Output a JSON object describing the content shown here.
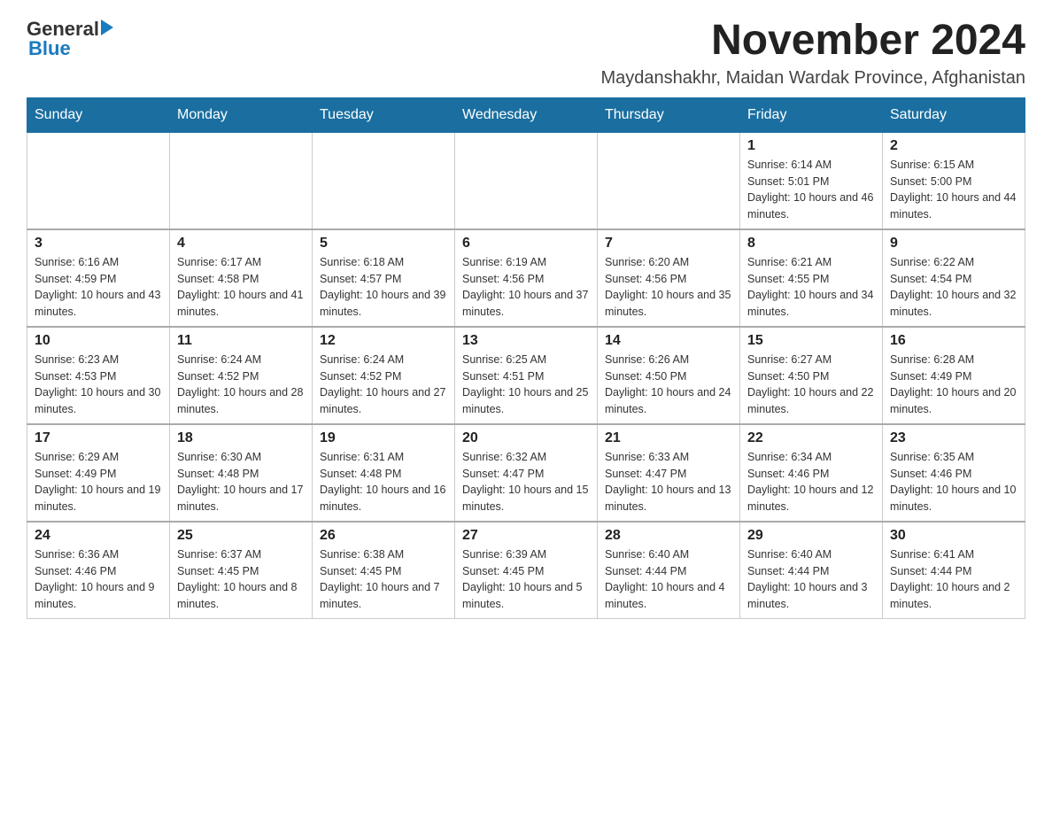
{
  "header": {
    "logo": {
      "general": "General",
      "blue": "Blue"
    },
    "month_year": "November 2024",
    "location": "Maydanshakhr, Maidan Wardak Province, Afghanistan"
  },
  "days_of_week": [
    "Sunday",
    "Monday",
    "Tuesday",
    "Wednesday",
    "Thursday",
    "Friday",
    "Saturday"
  ],
  "weeks": [
    [
      {
        "day": "",
        "info": ""
      },
      {
        "day": "",
        "info": ""
      },
      {
        "day": "",
        "info": ""
      },
      {
        "day": "",
        "info": ""
      },
      {
        "day": "",
        "info": ""
      },
      {
        "day": "1",
        "info": "Sunrise: 6:14 AM\nSunset: 5:01 PM\nDaylight: 10 hours and 46 minutes."
      },
      {
        "day": "2",
        "info": "Sunrise: 6:15 AM\nSunset: 5:00 PM\nDaylight: 10 hours and 44 minutes."
      }
    ],
    [
      {
        "day": "3",
        "info": "Sunrise: 6:16 AM\nSunset: 4:59 PM\nDaylight: 10 hours and 43 minutes."
      },
      {
        "day": "4",
        "info": "Sunrise: 6:17 AM\nSunset: 4:58 PM\nDaylight: 10 hours and 41 minutes."
      },
      {
        "day": "5",
        "info": "Sunrise: 6:18 AM\nSunset: 4:57 PM\nDaylight: 10 hours and 39 minutes."
      },
      {
        "day": "6",
        "info": "Sunrise: 6:19 AM\nSunset: 4:56 PM\nDaylight: 10 hours and 37 minutes."
      },
      {
        "day": "7",
        "info": "Sunrise: 6:20 AM\nSunset: 4:56 PM\nDaylight: 10 hours and 35 minutes."
      },
      {
        "day": "8",
        "info": "Sunrise: 6:21 AM\nSunset: 4:55 PM\nDaylight: 10 hours and 34 minutes."
      },
      {
        "day": "9",
        "info": "Sunrise: 6:22 AM\nSunset: 4:54 PM\nDaylight: 10 hours and 32 minutes."
      }
    ],
    [
      {
        "day": "10",
        "info": "Sunrise: 6:23 AM\nSunset: 4:53 PM\nDaylight: 10 hours and 30 minutes."
      },
      {
        "day": "11",
        "info": "Sunrise: 6:24 AM\nSunset: 4:52 PM\nDaylight: 10 hours and 28 minutes."
      },
      {
        "day": "12",
        "info": "Sunrise: 6:24 AM\nSunset: 4:52 PM\nDaylight: 10 hours and 27 minutes."
      },
      {
        "day": "13",
        "info": "Sunrise: 6:25 AM\nSunset: 4:51 PM\nDaylight: 10 hours and 25 minutes."
      },
      {
        "day": "14",
        "info": "Sunrise: 6:26 AM\nSunset: 4:50 PM\nDaylight: 10 hours and 24 minutes."
      },
      {
        "day": "15",
        "info": "Sunrise: 6:27 AM\nSunset: 4:50 PM\nDaylight: 10 hours and 22 minutes."
      },
      {
        "day": "16",
        "info": "Sunrise: 6:28 AM\nSunset: 4:49 PM\nDaylight: 10 hours and 20 minutes."
      }
    ],
    [
      {
        "day": "17",
        "info": "Sunrise: 6:29 AM\nSunset: 4:49 PM\nDaylight: 10 hours and 19 minutes."
      },
      {
        "day": "18",
        "info": "Sunrise: 6:30 AM\nSunset: 4:48 PM\nDaylight: 10 hours and 17 minutes."
      },
      {
        "day": "19",
        "info": "Sunrise: 6:31 AM\nSunset: 4:48 PM\nDaylight: 10 hours and 16 minutes."
      },
      {
        "day": "20",
        "info": "Sunrise: 6:32 AM\nSunset: 4:47 PM\nDaylight: 10 hours and 15 minutes."
      },
      {
        "day": "21",
        "info": "Sunrise: 6:33 AM\nSunset: 4:47 PM\nDaylight: 10 hours and 13 minutes."
      },
      {
        "day": "22",
        "info": "Sunrise: 6:34 AM\nSunset: 4:46 PM\nDaylight: 10 hours and 12 minutes."
      },
      {
        "day": "23",
        "info": "Sunrise: 6:35 AM\nSunset: 4:46 PM\nDaylight: 10 hours and 10 minutes."
      }
    ],
    [
      {
        "day": "24",
        "info": "Sunrise: 6:36 AM\nSunset: 4:46 PM\nDaylight: 10 hours and 9 minutes."
      },
      {
        "day": "25",
        "info": "Sunrise: 6:37 AM\nSunset: 4:45 PM\nDaylight: 10 hours and 8 minutes."
      },
      {
        "day": "26",
        "info": "Sunrise: 6:38 AM\nSunset: 4:45 PM\nDaylight: 10 hours and 7 minutes."
      },
      {
        "day": "27",
        "info": "Sunrise: 6:39 AM\nSunset: 4:45 PM\nDaylight: 10 hours and 5 minutes."
      },
      {
        "day": "28",
        "info": "Sunrise: 6:40 AM\nSunset: 4:44 PM\nDaylight: 10 hours and 4 minutes."
      },
      {
        "day": "29",
        "info": "Sunrise: 6:40 AM\nSunset: 4:44 PM\nDaylight: 10 hours and 3 minutes."
      },
      {
        "day": "30",
        "info": "Sunrise: 6:41 AM\nSunset: 4:44 PM\nDaylight: 10 hours and 2 minutes."
      }
    ]
  ]
}
